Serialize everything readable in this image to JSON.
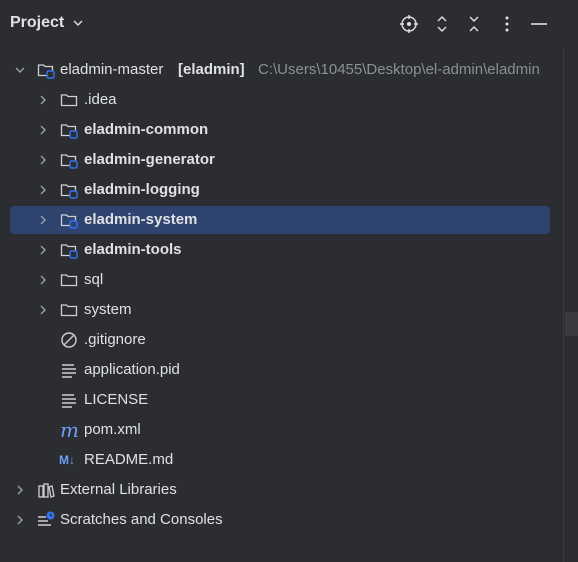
{
  "header": {
    "title": "Project",
    "icons": [
      "locate-icon",
      "expand-all-icon",
      "collapse-all-icon",
      "more-options-icon",
      "hide-panel-icon"
    ]
  },
  "tree": {
    "root": {
      "name": "eladmin-master",
      "module": "[eladmin]",
      "path": "C:\\Users\\10455\\Desktop\\el-admin\\eladmin"
    },
    "items": [
      {
        "label": ".idea",
        "icon": "folder"
      },
      {
        "label": "eladmin-common",
        "icon": "module-folder"
      },
      {
        "label": "eladmin-generator",
        "icon": "module-folder"
      },
      {
        "label": "eladmin-logging",
        "icon": "module-folder"
      },
      {
        "label": "eladmin-system",
        "icon": "module-folder"
      },
      {
        "label": "eladmin-tools",
        "icon": "module-folder"
      },
      {
        "label": "sql",
        "icon": "folder"
      },
      {
        "label": "system",
        "icon": "folder"
      },
      {
        "label": ".gitignore",
        "icon": "ignore-file"
      },
      {
        "label": "application.pid",
        "icon": "text-file"
      },
      {
        "label": "LICENSE",
        "icon": "text-file"
      },
      {
        "label": "pom.xml",
        "icon": "maven"
      },
      {
        "label": "README.md",
        "icon": "markdown"
      }
    ],
    "external_libraries": "External Libraries",
    "scratches": "Scratches and Consoles",
    "markdown_badge": "M↓",
    "maven_badge": "m"
  },
  "colors": {
    "background": "#2b2d30",
    "selection": "#2e436e",
    "text": "#dfe1e5",
    "path_text": "#8c8f94",
    "module_badge": "#3574f0",
    "maven": "#6e9ff4"
  }
}
